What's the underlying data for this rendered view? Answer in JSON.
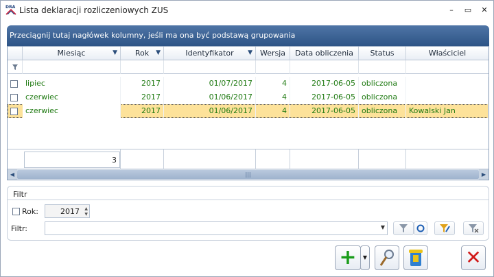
{
  "window": {
    "title": "Lista deklaracji rozliczeniowych ZUS",
    "logo_text": "DRA",
    "minimize": "–",
    "maximize": "▭",
    "close": "✕"
  },
  "grid": {
    "group_hint": "Przeciągnij tutaj nagłówek kolumny, jeśli ma ona być podstawą grupowania",
    "columns": [
      "Miesiąc",
      "Rok",
      "Identyfikator",
      "Wersja",
      "Data obliczenia",
      "Status",
      "Właściciel"
    ],
    "rows": [
      {
        "miesiac": "lipiec",
        "rok": "2017",
        "identyfikator": "01/07/2017",
        "wersja": "4",
        "data": "2017-06-05",
        "status": "obliczona",
        "wlasciciel": ""
      },
      {
        "miesiac": "czerwiec",
        "rok": "2017",
        "identyfikator": "01/06/2017",
        "wersja": "4",
        "data": "2017-06-05",
        "status": "obliczona",
        "wlasciciel": ""
      },
      {
        "miesiac": "czerwiec",
        "rok": "2017",
        "identyfikator": "01/06/2017",
        "wersja": "4",
        "data": "2017-06-05",
        "status": "obliczona",
        "wlasciciel": "Kowalski Jan"
      }
    ],
    "row_count": "3"
  },
  "filter": {
    "section_title": "Filtr",
    "rok_label": "Rok:",
    "rok_value": "2017",
    "filtr_label": "Filtr:",
    "filtr_value": ""
  },
  "colors": {
    "header_blue": "#2d5486",
    "row_text_green": "#1f7a12",
    "selected_row": "#fde29a"
  },
  "icons": {
    "add": "plus-icon",
    "edit": "magnifier-icon",
    "delete": "trash-icon",
    "cancel": "close-icon"
  }
}
